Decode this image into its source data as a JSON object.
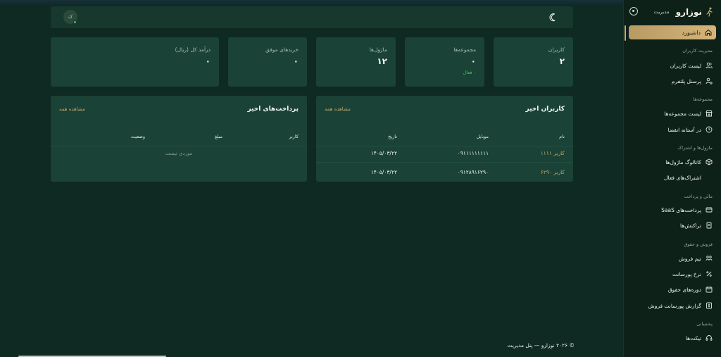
{
  "brand": {
    "name": "نوزارو",
    "subtitle": "مدیریت"
  },
  "sidebar": {
    "active": "داشبورد",
    "sections": [
      {
        "title": "مدیریت کاربران",
        "items": [
          "لیست کاربران",
          "پرسنل پلتفرم"
        ]
      },
      {
        "title": "مجموعه‌ها",
        "items": [
          "لیست مجموعه‌ها",
          "در آستانه انقضا"
        ]
      },
      {
        "title": "ماژول‌ها و اشتراک",
        "items": [
          "کاتالوگ ماژول‌ها",
          "اشتراک‌های فعال"
        ]
      },
      {
        "title": "مالی و پرداخت",
        "items": [
          "پرداخت‌های SaaS",
          "تراکنش‌ها"
        ]
      },
      {
        "title": "فروش و حقوق",
        "items": [
          "تیم فروش",
          "نرخ پورسانت",
          "دوره‌های حقوق",
          "گزارش پورسانت فروش"
        ]
      },
      {
        "title": "پشتیبانی",
        "items": [
          "تیکت‌ها"
        ]
      }
    ]
  },
  "header": {
    "avatar_initial": "ک"
  },
  "stats": [
    {
      "label": "کاربران",
      "value": "۲"
    },
    {
      "label": "مجموعه‌ها",
      "value": "۰",
      "note": "۰ فعال"
    },
    {
      "label": "ماژول‌ها",
      "value": "۱۲"
    },
    {
      "label": "خریدهای موفق",
      "value": "۰"
    },
    {
      "label": "درآمد کل (ریال)",
      "value": "۰"
    }
  ],
  "recent_users": {
    "title": "کاربران اخیر",
    "view_all": "مشاهده همه",
    "columns": [
      "نام",
      "موبایل",
      "تاریخ"
    ],
    "rows": [
      [
        "کاربر ۱۱۱۱",
        "۰۹۱۱۱۱۱۱۱۱۱",
        "۱۴۰۵/۰۳/۲۲"
      ],
      [
        "کاربر ۶۲۹۰",
        "۰۹۱۲۸۹۱۶۲۹۰",
        "۱۴۰۵/۰۳/۲۲"
      ]
    ]
  },
  "recent_payments": {
    "title": "پرداخت‌های اخیر",
    "view_all": "مشاهده همه",
    "columns": [
      "کاربر",
      "مبلغ",
      "وضعیت"
    ],
    "empty": "موردی نیست"
  },
  "footer": "© ۲۰۲۶ نوزارو — پنل مدیریت"
}
